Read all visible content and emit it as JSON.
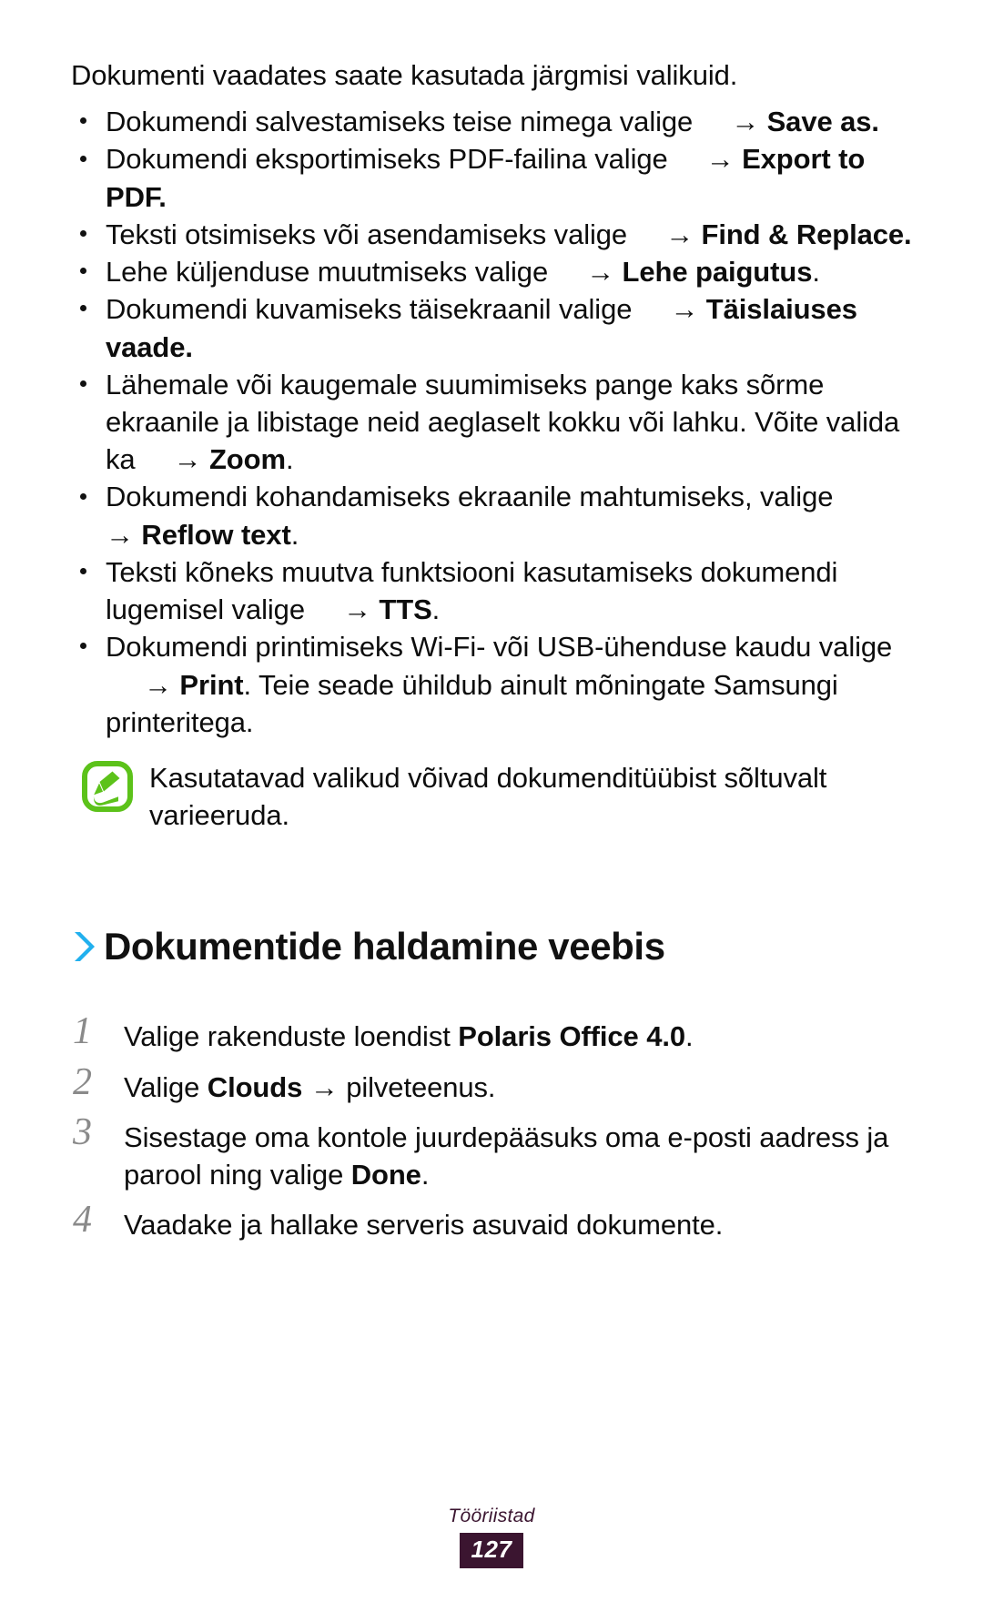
{
  "colors": {
    "accent_chevron": "#21B0EE",
    "note_icon_green": "#5CC21A",
    "footer_purple": "#3B1530",
    "step_number_gray": "#8A8A8A",
    "body_text": "#0D0D0D"
  },
  "intro": {
    "text": "Dokumenti vaadates saate kasutada järgmisi valikuid."
  },
  "bullets": [
    {
      "lead": "Dokumendi salvestamiseks teise nimega valige",
      "arrow": "→",
      "bold": "Save as",
      "tail": "."
    },
    {
      "lead": "Dokumendi eksportimiseks PDF-failina valige",
      "arrow": "→",
      "bold": "Export to PDF",
      "tail": "."
    },
    {
      "lead": "Teksti otsimiseks või asendamiseks valige",
      "arrow": "→",
      "bold": "Find & Replace",
      "tail": "."
    },
    {
      "lead": "Lehe küljenduse muutmiseks valige",
      "arrow": "→",
      "bold": "Lehe paigutus",
      "tail": "."
    },
    {
      "lead": "Dokumendi kuvamiseks täisekraanil valige",
      "arrow": "→",
      "bold": "Täislaiuses vaade",
      "tail": "."
    },
    {
      "lead": "Lähemale või kaugemale suumimiseks pange kaks sõrme ekraanile ja libistage neid aeglaselt kokku või lahku. Võite valida ka",
      "arrow": "→",
      "bold": "Zoom",
      "tail": "."
    },
    {
      "lead": "Dokumendi kohandamiseks ekraanile mahtumiseks, valige",
      "arrow": "→",
      "bold": "Reflow text",
      "tail": "."
    },
    {
      "lead": "Teksti kõneks muutva funktsiooni kasutamiseks dokumendi lugemisel valige",
      "arrow": "→",
      "bold": "TTS",
      "tail": "."
    },
    {
      "lead": "Dokumendi printimiseks Wi-Fi- või USB-ühenduse kaudu valige",
      "arrow": "→",
      "bold": "Print",
      "tail": ". Teie seade ühildub ainult mõningate Samsungi printeritega."
    }
  ],
  "note": {
    "icon": "samsung-note-pen-icon",
    "text": "Kasutatavad valikud võivad dokumenditüübist sõltuvalt varieeruda."
  },
  "section": {
    "chevron_icon": "chevron-right-icon",
    "title": "Dokumentide haldamine veebis"
  },
  "steps": [
    {
      "number": "1",
      "lead": "Valige rakenduste loendist ",
      "bold": "Polaris Office 4.0",
      "tail": "."
    },
    {
      "number": "2",
      "lead": "Valige ",
      "bold": "Clouds",
      "arrow": " → ",
      "tail": "pilveteenus."
    },
    {
      "number": "3",
      "lead": "Sisestage oma kontole juurdepääsuks oma e-posti aadress ja parool ning valige ",
      "bold": "Done",
      "tail": "."
    },
    {
      "number": "4",
      "lead": "Vaadake ja hallake serveris asuvaid dokumente.",
      "bold": "",
      "tail": ""
    }
  ],
  "footer": {
    "chapter": "Tööriistad",
    "page_number": "127"
  }
}
